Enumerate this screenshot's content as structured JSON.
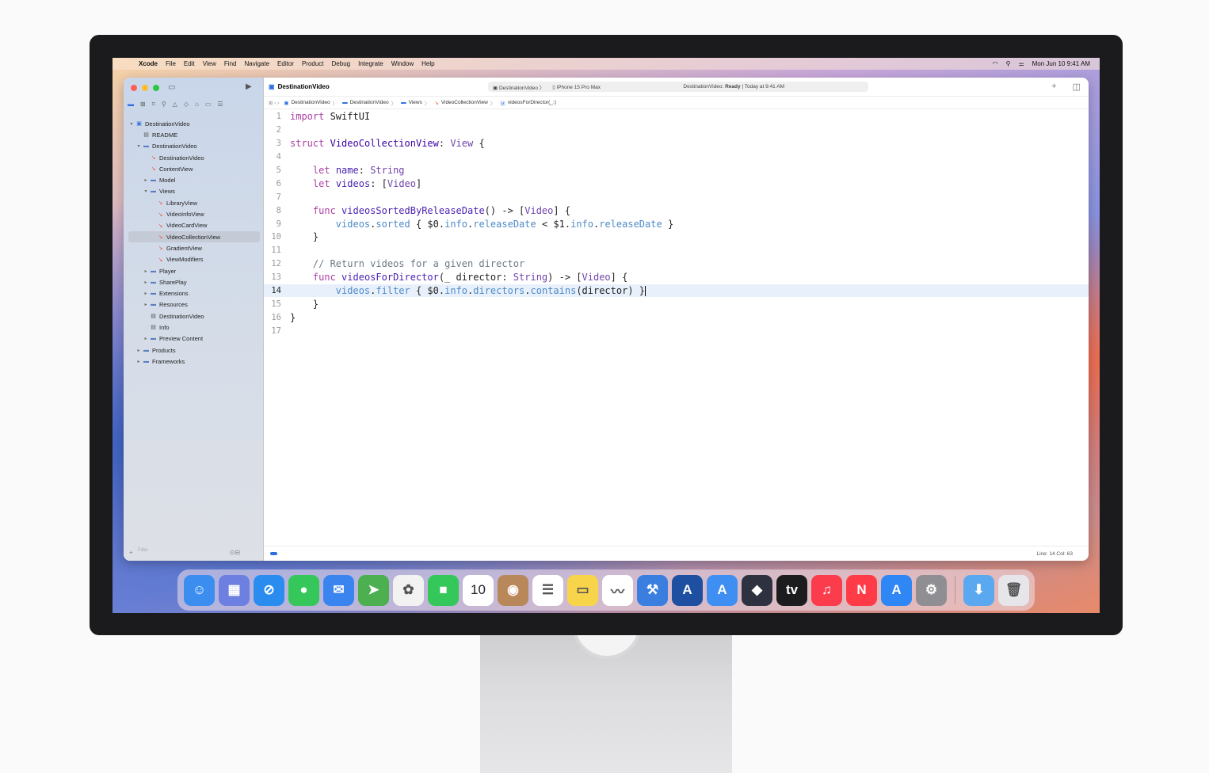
{
  "menubar": {
    "apple": "",
    "items": [
      "Xcode",
      "File",
      "Edit",
      "View",
      "Find",
      "Navigate",
      "Editor",
      "Product",
      "Debug",
      "Integrate",
      "Window",
      "Help"
    ],
    "clock": "Mon Jun 10  9:41 AM"
  },
  "toolbar": {
    "project": "DestinationVideo",
    "scheme": "DestinationVideo",
    "device": "iPhone 15 Pro Max",
    "status_prefix": "DestinationVideo:",
    "status": "Ready",
    "status_time": "| Today at 9:41 AM"
  },
  "jumpbar": [
    "DestinationVideo",
    "DestinationVideo",
    "Views",
    "VideoCollectionView",
    "videosForDirector(_:)"
  ],
  "tree": [
    {
      "label": "DestinationVideo",
      "icon": "proj",
      "depth": 0,
      "chev": "v"
    },
    {
      "label": "README",
      "icon": "doc",
      "depth": 1,
      "chev": ""
    },
    {
      "label": "DestinationVideo",
      "icon": "folder",
      "depth": 1,
      "chev": "v"
    },
    {
      "label": "DestinationVideo",
      "icon": "swift",
      "depth": 2,
      "chev": ""
    },
    {
      "label": "ContentView",
      "icon": "swift",
      "depth": 2,
      "chev": ""
    },
    {
      "label": "Model",
      "icon": "folder",
      "depth": 2,
      "chev": ">"
    },
    {
      "label": "Views",
      "icon": "folder",
      "depth": 2,
      "chev": "v"
    },
    {
      "label": "LibraryView",
      "icon": "swift",
      "depth": 3,
      "chev": ""
    },
    {
      "label": "VideoInfoView",
      "icon": "swift",
      "depth": 3,
      "chev": ""
    },
    {
      "label": "VideoCardView",
      "icon": "swift",
      "depth": 3,
      "chev": ""
    },
    {
      "label": "VideoCollectionView",
      "icon": "swift",
      "depth": 3,
      "chev": "",
      "selected": true
    },
    {
      "label": "GradientView",
      "icon": "swift",
      "depth": 3,
      "chev": ""
    },
    {
      "label": "ViewModifiers",
      "icon": "swift",
      "depth": 3,
      "chev": ""
    },
    {
      "label": "Player",
      "icon": "folder",
      "depth": 2,
      "chev": ">"
    },
    {
      "label": "SharePlay",
      "icon": "folder",
      "depth": 2,
      "chev": ">"
    },
    {
      "label": "Extensions",
      "icon": "folder",
      "depth": 2,
      "chev": ">"
    },
    {
      "label": "Resources",
      "icon": "folder",
      "depth": 2,
      "chev": ">"
    },
    {
      "label": "DestinationVideo",
      "icon": "doc",
      "depth": 2,
      "chev": ""
    },
    {
      "label": "Info",
      "icon": "doc",
      "depth": 2,
      "chev": ""
    },
    {
      "label": "Preview Content",
      "icon": "folder",
      "depth": 2,
      "chev": ">"
    },
    {
      "label": "Products",
      "icon": "folder",
      "depth": 1,
      "chev": ">"
    },
    {
      "label": "Frameworks",
      "icon": "folder",
      "depth": 1,
      "chev": ">"
    }
  ],
  "filter_placeholder": "Filter",
  "code": [
    {
      "n": "1",
      "html": "<span class=\"k\">import</span> SwiftUI"
    },
    {
      "n": "2",
      "html": ""
    },
    {
      "n": "3",
      "html": "<span class=\"k\">struct</span> <span class=\"t\">VideoCollectionView</span>: <span class=\"ty\">View</span> {"
    },
    {
      "n": "4",
      "html": ""
    },
    {
      "n": "5",
      "html": "    <span class=\"k\">let</span> <span class=\"f\">name</span>: <span class=\"ty\">String</span>"
    },
    {
      "n": "6",
      "html": "    <span class=\"k\">let</span> <span class=\"f\">videos</span>: [<span class=\"ty\">Video</span>]"
    },
    {
      "n": "7",
      "html": ""
    },
    {
      "n": "8",
      "html": "    <span class=\"k\">func</span> <span class=\"f\">videosSortedByReleaseDate</span>() -> [<span class=\"ty\">Video</span>] {"
    },
    {
      "n": "9",
      "html": "        <span class=\"p\">videos</span>.<span class=\"p\">sorted</span> { $0.<span class=\"p\">info</span>.<span class=\"p\">releaseDate</span> < $1.<span class=\"p\">info</span>.<span class=\"p\">releaseDate</span> }"
    },
    {
      "n": "10",
      "html": "    }"
    },
    {
      "n": "11",
      "html": ""
    },
    {
      "n": "12",
      "html": "    <span class=\"c\">// Return videos for a given director</span>"
    },
    {
      "n": "13",
      "html": "    <span class=\"k\">func</span> <span class=\"f\">videosForDirector</span>(_ director: <span class=\"ty\">String</span>) -> [<span class=\"ty\">Video</span>] {"
    },
    {
      "n": "14",
      "html": "        <span class=\"p\">videos</span>.<span class=\"p\">filter</span> { $0.<span class=\"p\">info</span>.<span class=\"p\">directors</span>.<span class=\"p\">contains</span>(director) }<span class=\"cursor\"></span>",
      "current": true
    },
    {
      "n": "15",
      "html": "    }"
    },
    {
      "n": "16",
      "html": "}"
    },
    {
      "n": "17",
      "html": ""
    }
  ],
  "status": {
    "line_col": "Line: 14  Col: 63"
  },
  "dock": [
    {
      "name": "finder-icon",
      "bg": "#3b8ef0",
      "glyph": "☺"
    },
    {
      "name": "launchpad-icon",
      "bg": "#6d7fe0",
      "glyph": "▦"
    },
    {
      "name": "safari-icon",
      "bg": "#2b8cf0",
      "glyph": "⊘"
    },
    {
      "name": "messages-icon",
      "bg": "#35c759",
      "glyph": "●"
    },
    {
      "name": "mail-icon",
      "bg": "#3a84f0",
      "glyph": "✉"
    },
    {
      "name": "maps-icon",
      "bg": "#4caf50",
      "glyph": "➤"
    },
    {
      "name": "photos-icon",
      "bg": "#f2f2f2",
      "glyph": "✿"
    },
    {
      "name": "facetime-icon",
      "bg": "#34c759",
      "glyph": "■"
    },
    {
      "name": "calendar-icon",
      "bg": "#ffffff",
      "glyph": "10"
    },
    {
      "name": "contacts-icon",
      "bg": "#b8875a",
      "glyph": "◉"
    },
    {
      "name": "reminders-icon",
      "bg": "#ffffff",
      "glyph": "☰"
    },
    {
      "name": "notes-icon",
      "bg": "#f7d44a",
      "glyph": "▭"
    },
    {
      "name": "freeform-icon",
      "bg": "#ffffff",
      "glyph": "〰"
    },
    {
      "name": "xcode-icon",
      "bg": "#3a7fe0",
      "glyph": "⚒"
    },
    {
      "name": "instruments-icon",
      "bg": "#1f4fa0",
      "glyph": "A"
    },
    {
      "name": "simulator-icon",
      "bg": "#3f8ef2",
      "glyph": "A"
    },
    {
      "name": "reality-composer-icon",
      "bg": "#2e3240",
      "glyph": "◆"
    },
    {
      "name": "apple-tv-icon",
      "bg": "#1c1c1e",
      "glyph": "tv"
    },
    {
      "name": "music-icon",
      "bg": "#fa3c4c",
      "glyph": "♫"
    },
    {
      "name": "news-icon",
      "bg": "#ff3b47",
      "glyph": "N"
    },
    {
      "name": "app-store-icon",
      "bg": "#2f86f5",
      "glyph": "A"
    },
    {
      "name": "system-settings-icon",
      "bg": "#8e8e93",
      "glyph": "⚙"
    },
    {
      "name": "downloads-icon",
      "bg": "#5aa8f0",
      "glyph": "⬇"
    },
    {
      "name": "trash-icon",
      "bg": "#e5e5ea",
      "glyph": "🗑"
    }
  ]
}
